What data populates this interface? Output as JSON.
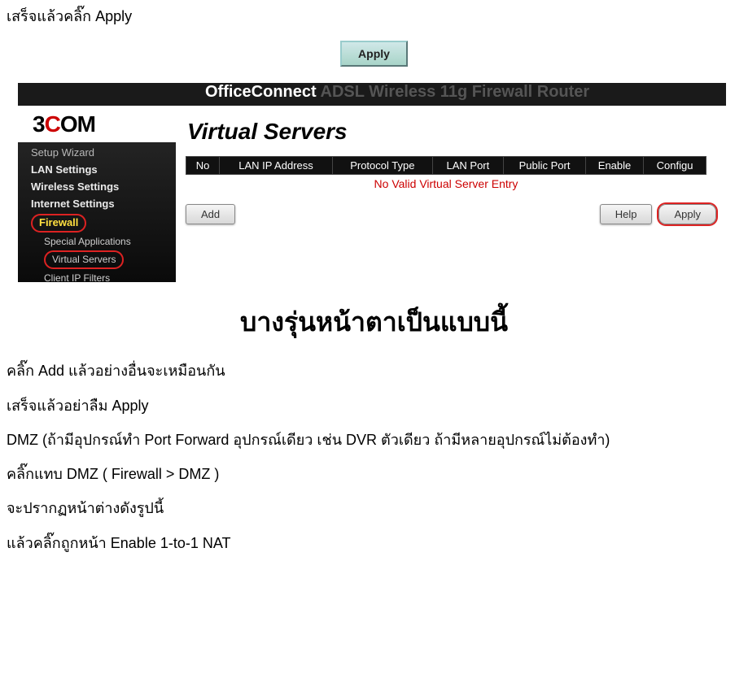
{
  "intro_text": "เสร็จแล้วคลิ๊ก Apply",
  "apply_button_label": "Apply",
  "router": {
    "top_left": "OfficeConnect",
    "top_right": "ADSL Wireless 11g Firewall Router",
    "logo_prefix": "3",
    "logo_mid": "C",
    "logo_suffix": "OM",
    "menu": {
      "setup_wizard": "Setup Wizard",
      "lan_settings": "LAN Settings",
      "wireless_settings": "Wireless Settings",
      "internet_settings": "Internet Settings",
      "firewall": "Firewall",
      "special_apps": "Special Applications",
      "virtual_servers": "Virtual Servers",
      "client_filters": "Client IP Filters"
    },
    "content": {
      "heading": "Virtual Servers",
      "columns": [
        "No",
        "LAN IP Address",
        "Protocol Type",
        "LAN Port",
        "Public Port",
        "Enable",
        "Configu"
      ],
      "empty_row": "No Valid Virtual Server Entry",
      "add_label": "Add",
      "help_label": "Help",
      "apply_label": "Apply"
    }
  },
  "section_title": "บางรุ่นหน้าตาเป็นแบบนี้",
  "paragraphs": {
    "p1": "คลิ๊ก Add แล้วอย่างอื่นจะเหมือนกัน",
    "p2": "เสร็จแล้วอย่าลืม Apply",
    "p3": "DMZ (ถ้ามีอุปกรณ์ทำ Port Forward อุปกรณ์เดียว เช่น DVR ตัวเดียว ถ้ามีหลายอุปกรณ์ไม่ต้องทำ)",
    "p4": "คลิ๊กแทบ DMZ ( Firewall > DMZ )",
    "p5": "จะปรากฏหน้าต่างดังรูปนี้",
    "p6": "แล้วคลิ๊กถูกหน้า Enable 1-to-1 NAT"
  }
}
